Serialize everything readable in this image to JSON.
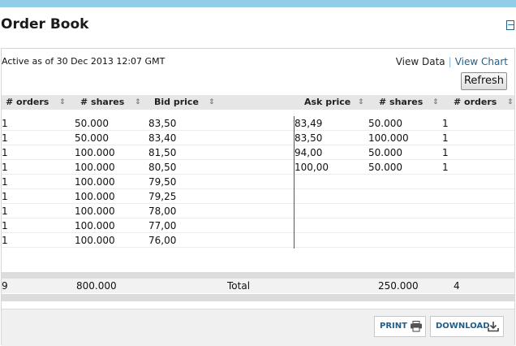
{
  "widget": {
    "title": "Order Book",
    "collapse_icon": "minus-box-icon"
  },
  "status": {
    "active_text": "Active as of 30 Dec 2013 12:07 GMT"
  },
  "links": {
    "view_data": "View Data",
    "separator": "|",
    "view_chart": "View Chart"
  },
  "refresh_label": "Refresh",
  "columns": {
    "bid_orders": "# orders",
    "bid_shares": "# shares",
    "bid_price": "Bid price",
    "ask_price": "Ask price",
    "ask_shares": "# shares",
    "ask_orders": "# orders",
    "sort_icon": "sort-arrows-icon"
  },
  "bids": [
    {
      "orders": "1",
      "shares": "50.000",
      "price": "83,50"
    },
    {
      "orders": "1",
      "shares": "50.000",
      "price": "83,40"
    },
    {
      "orders": "1",
      "shares": "100.000",
      "price": "81,50"
    },
    {
      "orders": "1",
      "shares": "100.000",
      "price": "80,50"
    },
    {
      "orders": "1",
      "shares": "100.000",
      "price": "79,50"
    },
    {
      "orders": "1",
      "shares": "100.000",
      "price": "79,25"
    },
    {
      "orders": "1",
      "shares": "100.000",
      "price": "78,00"
    },
    {
      "orders": "1",
      "shares": "100.000",
      "price": "77,00"
    },
    {
      "orders": "1",
      "shares": "100.000",
      "price": "76,00"
    }
  ],
  "asks": [
    {
      "price": "83,49",
      "shares": "50.000",
      "orders": "1"
    },
    {
      "price": "83,50",
      "shares": "100.000",
      "orders": "1"
    },
    {
      "price": "94,00",
      "shares": "50.000",
      "orders": "1"
    },
    {
      "price": "100,00",
      "shares": "50.000",
      "orders": "1"
    }
  ],
  "totals": {
    "bid_orders": "9",
    "bid_shares": "800.000",
    "label": "Total",
    "ask_shares": "250.000",
    "ask_orders": "4"
  },
  "footer": {
    "print_label": "PRINT",
    "print_icon": "printer-icon",
    "download_label": "DOWNLOAD",
    "download_icon": "download-icon"
  }
}
